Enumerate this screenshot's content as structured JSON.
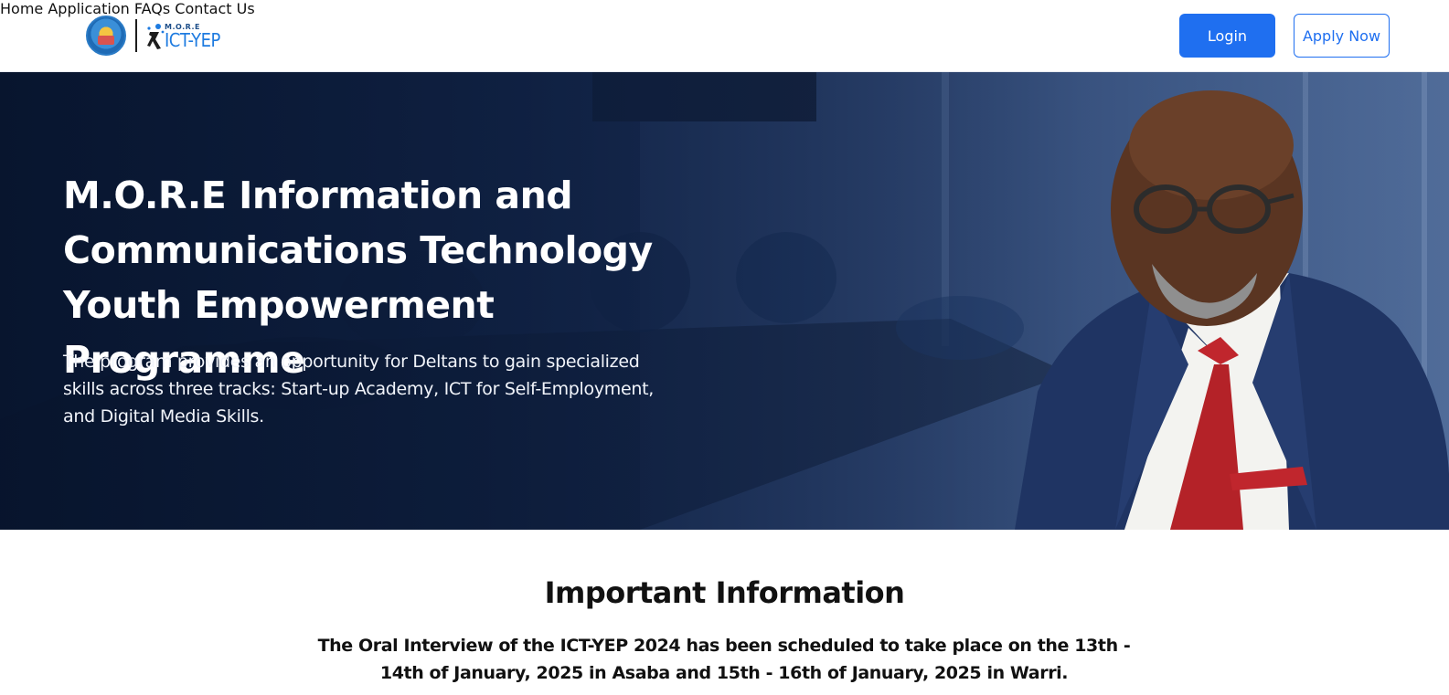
{
  "header": {
    "logo": {
      "seal_icon": "delta-state-seal-icon",
      "mark_small_text": "M.O.R.E",
      "mark_text": "ICT-YEP"
    },
    "nav": [
      {
        "label": "Home"
      },
      {
        "label": "Application"
      },
      {
        "label": "FAQs"
      },
      {
        "label": "Contact Us"
      }
    ],
    "login_label": "Login",
    "apply_label": "Apply Now"
  },
  "hero": {
    "title": "M.O.R.E Information and Communications Technology Youth Empowerment Programme",
    "description": "The program provides an opportunity for Deltans to gain specialized skills across three tracks: Start-up Academy, ICT for Self-Employment, and Digital Media Skills."
  },
  "info": {
    "title": "Important Information",
    "text": "The Oral Interview of the ICT-YEP 2024 has been scheduled to take place on the 13th - 14th of January, 2025 in Asaba and 15th - 16th of January, 2025 in Warri."
  },
  "colors": {
    "primary": "#1f6ff0",
    "hero_dark": "#0c1b36",
    "hero_light": "#6a86b0"
  }
}
